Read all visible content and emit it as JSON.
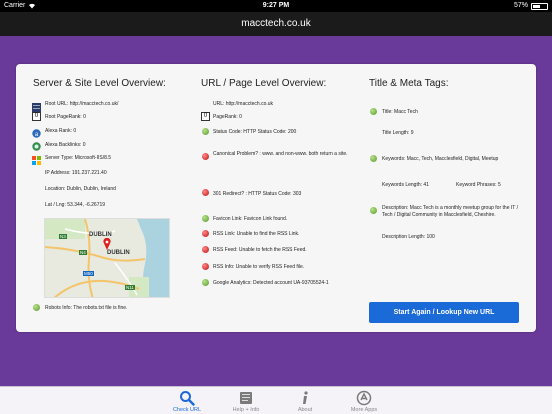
{
  "status_bar": {
    "carrier": "Carrier",
    "time": "9:27 PM",
    "battery": "57%",
    "battery_level": 0.57
  },
  "nav": {
    "title": "macctech.co.uk"
  },
  "server": {
    "heading": "Server & Site Level Overview:",
    "root_url": "Root URL: http://macctech.co.uk/",
    "root_pagerank": "Root PageRank: 0",
    "pagerank_badge": "0",
    "alexa_rank": "Alexa Rank: 0",
    "alexa_backlinks": "Alexa Backlinks: 0",
    "server_type": "Server Type: Microsoft-IIS/8.5",
    "ip_address": "IP Address: 191.237.221.40",
    "location": "Location: Dublin, Dublin, Ireland",
    "lat_lng": "Lat / Lng: 53.344, -6.26719",
    "robots": "Robots Info: The robots.txt file is fine."
  },
  "map": {
    "labels": {
      "dublin": "DUBLIN",
      "dubln": "DUBLIN",
      "road_n3": "N3",
      "road_n4": "N4",
      "road_m50": "M50",
      "road_n11": "N11"
    }
  },
  "url": {
    "heading": "URL / Page Level Overview:",
    "url": "URL: http://macctech.co.uk",
    "pagerank": "PageRank: 0",
    "pagerank_badge": "0",
    "status_code": "Status Code: HTTP Status Code: 200",
    "canonical": "Canonical Problem? : www. and non-www. both return a site.",
    "redirect": "301 Redirect? : HTTP Status Code: 303",
    "favicon": "Favicon Link: Favicon Link found.",
    "rss_link": "RSS Link: Unable to find the RSS Link.",
    "rss_feed": "RSS Feed: Unable to fetch the RSS Feed.",
    "rss_info": "RSS Info: Unable to verify RSS Feed file.",
    "analytics": "Google Analytics: Detected account UA-93705524-1"
  },
  "meta": {
    "heading": "Title & Meta Tags:",
    "title": "Title: Macc Tech",
    "title_length": "Title Length: 9",
    "keywords": "Keywords: Macc, Tech, Macclesfield, Digital, Meetup",
    "keywords_length": "Keywords Length: 41",
    "keyword_phrases": "Keyword Phrases: 5",
    "description": "Description: Macc Tech is a monthly meetup group for the IT / Tech / Digital Community in Macclesfield, Cheshire.",
    "description_length": "Description Length: 100"
  },
  "cta": {
    "label": "Start Again / Lookup New URL"
  },
  "tabs": [
    {
      "label": "Check URL",
      "icon": "search-icon"
    },
    {
      "label": "Help + Info",
      "icon": "book-icon"
    },
    {
      "label": "About",
      "icon": "info-icon"
    },
    {
      "label": "More Apps",
      "icon": "apps-icon"
    }
  ],
  "colors": {
    "background": "#6a3a9a",
    "accent": "#1a6ad8",
    "ok": "#5a9a2c",
    "error": "#c01010"
  }
}
